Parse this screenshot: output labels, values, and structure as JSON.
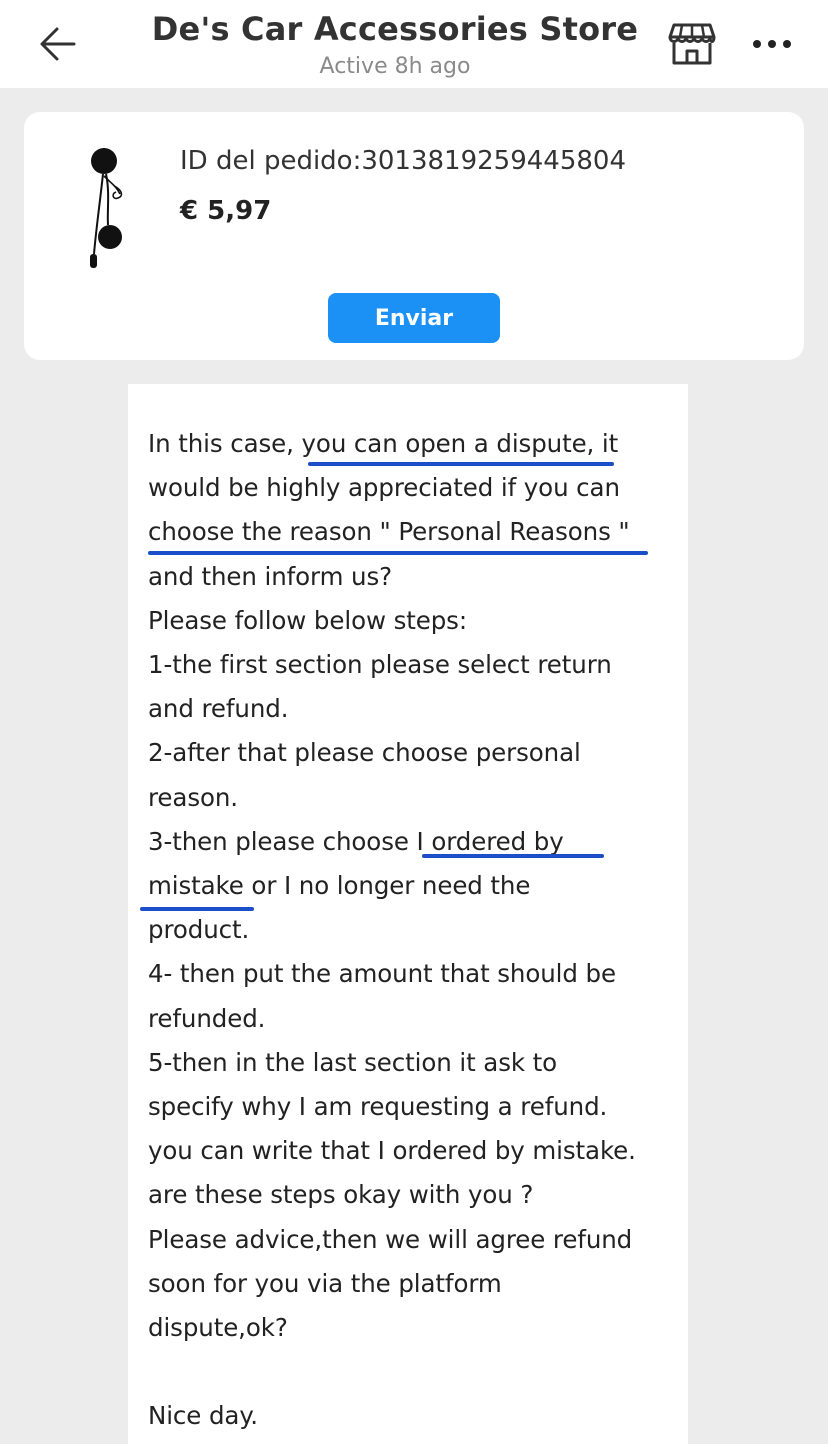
{
  "header": {
    "back_icon": "arrow-left-icon",
    "title": "De's Car Accessories Store",
    "status": "Active 8h ago",
    "store_icon": "storefront-icon",
    "more_icon": "more-horizontal-icon"
  },
  "order": {
    "product_image": "earphone-headset-product",
    "order_id": "ID del pedido:3013819259445804",
    "price": "€ 5,97",
    "send_label": "Enviar"
  },
  "message": {
    "text": "In this case, you can open a dispute, it\nwould be highly appreciated if you can\nchoose the reason \" Personal Reasons \"\nand then inform us?\nPlease follow below steps:\n1-the first section please select return\nand refund.\n2-after that please choose personal\nreason.\n3-then please choose I ordered by\nmistake or I no longer need the\nproduct.\n4- then put the amount that should be\nrefunded.\n5-then in the last section it ask to\nspecify why I am requesting a refund.\nyou can write that I ordered by mistake.\nare these steps okay with you ?\nPlease advice,then we will agree refund\nsoon for you via the platform\ndispute,ok?\n\nNice day.",
    "annotation_color": "#1a4fc9"
  },
  "colors": {
    "accent": "#1b90f5",
    "background": "#ececec",
    "card": "#ffffff"
  }
}
